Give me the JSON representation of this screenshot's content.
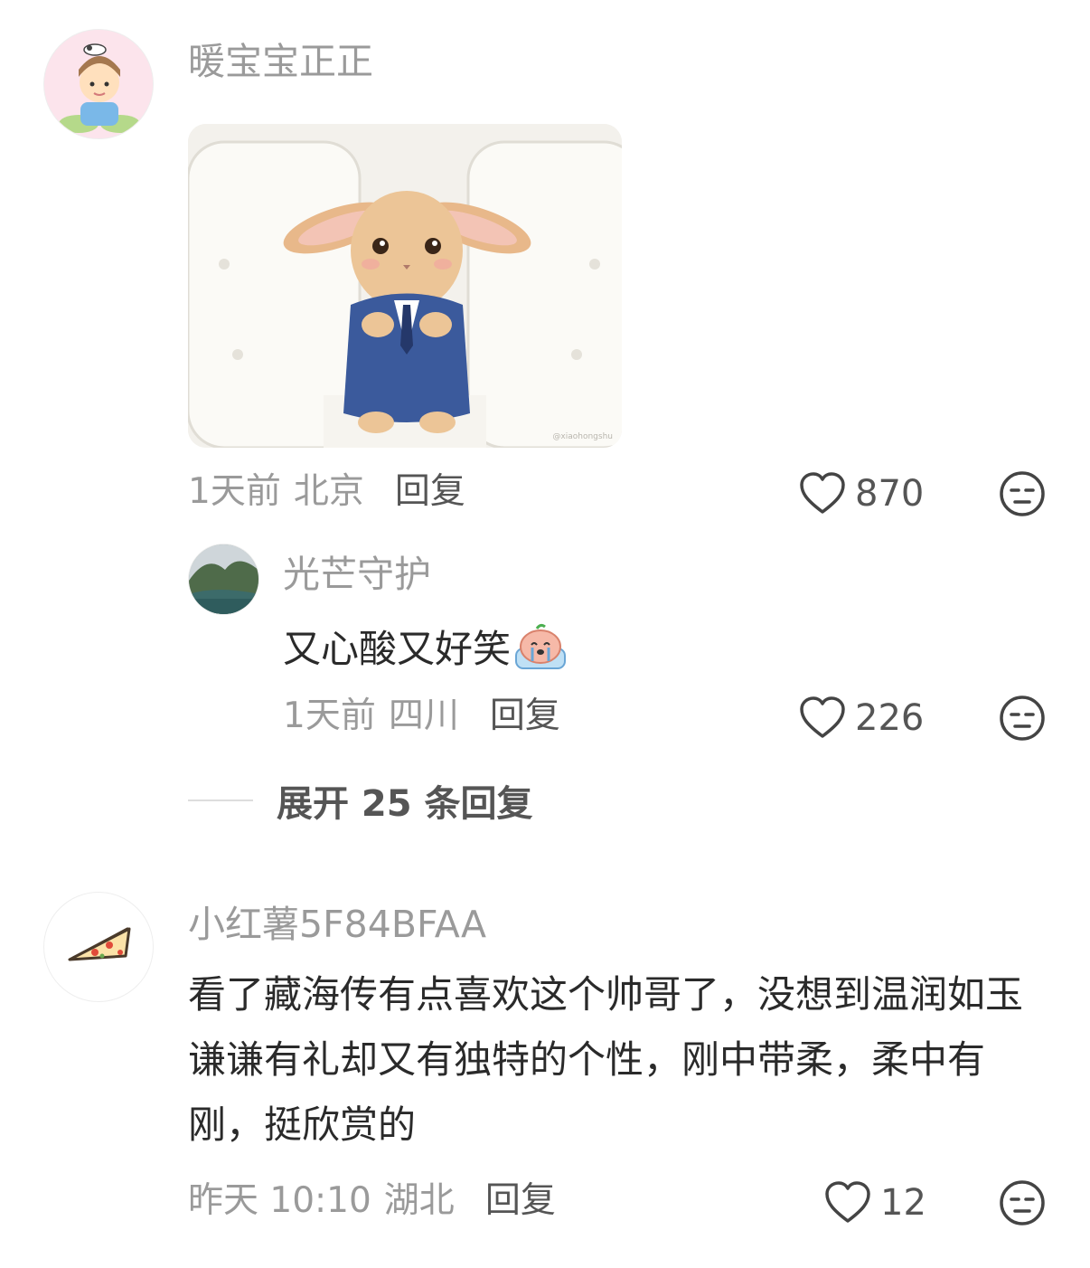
{
  "comments": [
    {
      "username": "暖宝宝正正",
      "time": "1天前",
      "location": "北京",
      "reply_label": "回复",
      "likes": "870",
      "image_desc": "bunny-in-suit-image",
      "image_watermark": "@xiaohongshu",
      "replies": [
        {
          "username": "光芒守护",
          "text": "又心酸又好笑",
          "time": "1天前",
          "location": "四川",
          "reply_label": "回复",
          "likes": "226"
        }
      ],
      "expand_label": "展开 25 条回复"
    },
    {
      "username": "小红薯5F84BFAA",
      "text": "看了藏海传有点喜欢这个帅哥了，没想到温润如玉谦谦有礼却又有独特的个性，刚中带柔，柔中有刚，挺欣赏的",
      "time": "昨天 10:10",
      "location": "湖北",
      "reply_label": "回复",
      "likes": "12"
    }
  ],
  "colors": {
    "meta_gray": "#9a9a9a",
    "text_dark": "#2a2a2a",
    "action_gray": "#555555"
  }
}
